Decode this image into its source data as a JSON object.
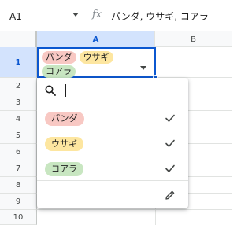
{
  "formula_bar": {
    "cell_ref": "A1",
    "fx_symbol": "fx",
    "formula": "パンダ, ウサギ, コアラ"
  },
  "columns": [
    "A",
    "B"
  ],
  "rows": [
    "1",
    "2",
    "3",
    "4",
    "5",
    "6",
    "7",
    "8",
    "9",
    "10"
  ],
  "selected_cell": {
    "chips": [
      {
        "label": "パンダ",
        "color": "#f8c8c3"
      },
      {
        "label": "ウサギ",
        "color": "#fde6a0"
      },
      {
        "label": "コアラ",
        "color": "#c8e6c1"
      }
    ]
  },
  "dropdown": {
    "search_placeholder": "",
    "options": [
      {
        "label": "パンダ",
        "color": "#f8c8c3",
        "checked": true
      },
      {
        "label": "ウサギ",
        "color": "#fde6a0",
        "checked": true
      },
      {
        "label": "コアラ",
        "color": "#c8e6c1",
        "checked": true
      }
    ],
    "edit_icon": "pencil-icon"
  },
  "accent_color": "#0b57d0"
}
